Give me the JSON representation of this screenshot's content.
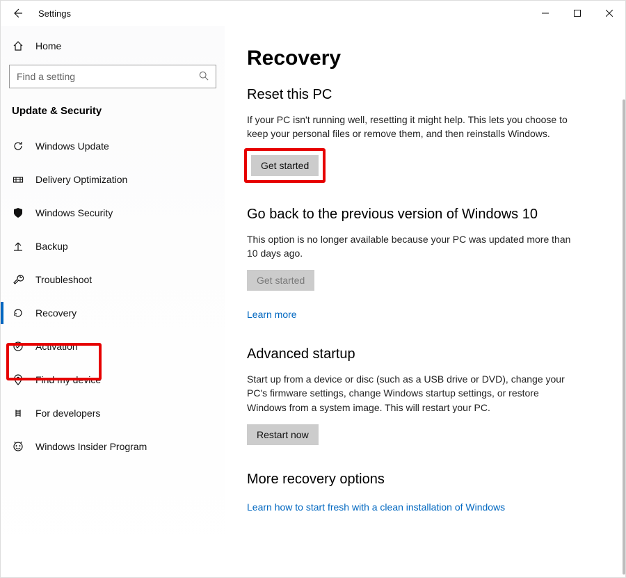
{
  "window": {
    "title": "Settings"
  },
  "sidebar": {
    "home_label": "Home",
    "search_placeholder": "Find a setting",
    "category_label": "Update & Security",
    "items": [
      {
        "label": "Windows Update",
        "icon": "sync"
      },
      {
        "label": "Delivery Optimization",
        "icon": "delivery"
      },
      {
        "label": "Windows Security",
        "icon": "shield"
      },
      {
        "label": "Backup",
        "icon": "backup"
      },
      {
        "label": "Troubleshoot",
        "icon": "troubleshoot"
      },
      {
        "label": "Recovery",
        "icon": "recovery",
        "active": true
      },
      {
        "label": "Activation",
        "icon": "activation"
      },
      {
        "label": "Find my device",
        "icon": "findmydevice"
      },
      {
        "label": "For developers",
        "icon": "developers"
      },
      {
        "label": "Windows Insider Program",
        "icon": "insider"
      }
    ]
  },
  "main": {
    "page_title": "Recovery",
    "sections": {
      "reset": {
        "heading": "Reset this PC",
        "desc": "If your PC isn't running well, resetting it might help. This lets you choose to keep your personal files or remove them, and then reinstalls Windows.",
        "button": "Get started"
      },
      "goback": {
        "heading": "Go back to the previous version of Windows 10",
        "desc": "This option is no longer available because your PC was updated more than 10 days ago.",
        "button": "Get started",
        "link": "Learn more"
      },
      "advanced": {
        "heading": "Advanced startup",
        "desc": "Start up from a device or disc (such as a USB drive or DVD), change your PC's firmware settings, change Windows startup settings, or restore Windows from a system image. This will restart your PC.",
        "button": "Restart now"
      },
      "more": {
        "heading": "More recovery options",
        "link": "Learn how to start fresh with a clean installation of Windows"
      }
    }
  }
}
